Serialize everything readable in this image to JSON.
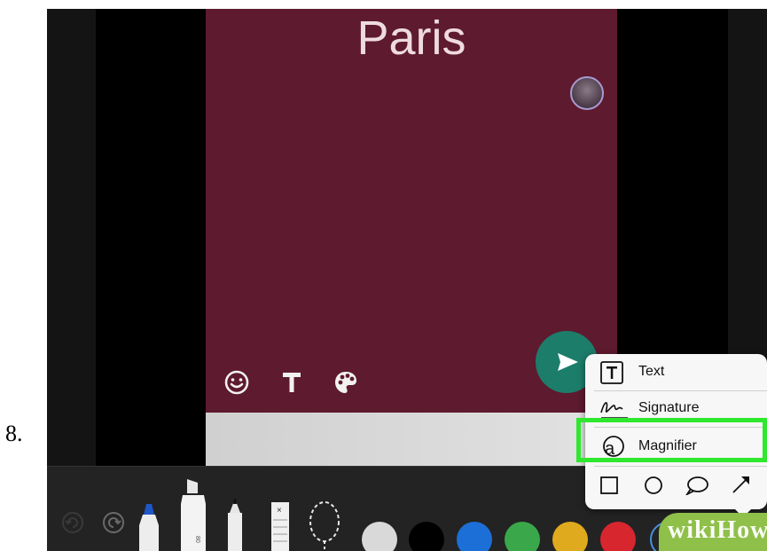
{
  "step_number": "8.",
  "card": {
    "title": "Paris",
    "background": "#5e1a2e"
  },
  "send_button": {
    "color": "#1c7d6a"
  },
  "markup_menu": {
    "items": [
      {
        "label": "Text",
        "icon": "text-box-icon"
      },
      {
        "label": "Signature",
        "icon": "signature-icon"
      },
      {
        "label": "Magnifier",
        "icon": "magnifier-icon"
      }
    ],
    "shapes": [
      "square-shape-icon",
      "circle-shape-icon",
      "speech-bubble-icon",
      "arrow-shape-icon"
    ],
    "highlight_color": "#2ee82e"
  },
  "toolbar": {
    "tools": [
      "undo-icon",
      "redo-icon",
      "pen-tool-icon",
      "marker-tool-icon",
      "pencil-tool-icon",
      "eraser-tool-icon",
      "lasso-tool-icon"
    ],
    "colors": [
      "#d9d9d9",
      "#000000",
      "#1c6fd6",
      "#3aa84a",
      "#e0aa1e",
      "#d8262f"
    ]
  },
  "watermark": "wikiHow"
}
